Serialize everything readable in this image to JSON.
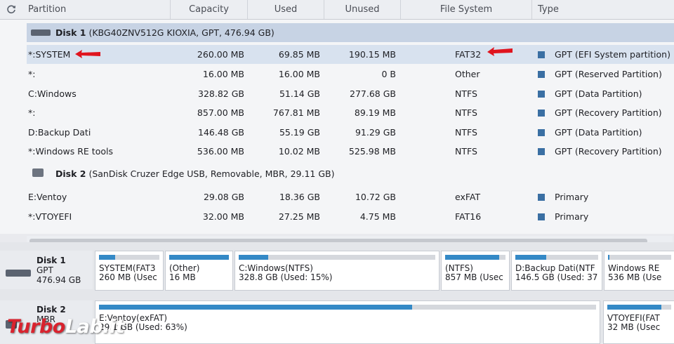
{
  "header": {
    "columns": [
      "Partition",
      "Capacity",
      "Used",
      "Unused",
      "File System",
      "Type"
    ]
  },
  "disk1": {
    "label": "Disk 1",
    "details": "(KBG40ZNV512G KIOXIA, GPT, 476.94 GB)",
    "partitions": [
      {
        "name": "*:SYSTEM",
        "capacity": "260.00 MB",
        "used": "69.85 MB",
        "unused": "190.15 MB",
        "fs": "FAT32",
        "type": "GPT (EFI System partition)"
      },
      {
        "name": "*:",
        "capacity": "16.00 MB",
        "used": "16.00 MB",
        "unused": "0 B",
        "fs": "Other",
        "type": "GPT (Reserved Partition)"
      },
      {
        "name": "C:Windows",
        "capacity": "328.82 GB",
        "used": "51.14 GB",
        "unused": "277.68 GB",
        "fs": "NTFS",
        "type": "GPT (Data Partition)"
      },
      {
        "name": "*:",
        "capacity": "857.00 MB",
        "used": "767.81 MB",
        "unused": "89.19 MB",
        "fs": "NTFS",
        "type": "GPT (Recovery Partition)"
      },
      {
        "name": "D:Backup Dati",
        "capacity": "146.48 GB",
        "used": "55.19 GB",
        "unused": "91.29 GB",
        "fs": "NTFS",
        "type": "GPT (Data Partition)"
      },
      {
        "name": "*:Windows RE tools",
        "capacity": "536.00 MB",
        "used": "10.02 MB",
        "unused": "525.98 MB",
        "fs": "NTFS",
        "type": "GPT (Recovery Partition)"
      }
    ]
  },
  "disk2": {
    "label": "Disk 2",
    "details": "(SanDisk Cruzer Edge USB, Removable, MBR, 29.11 GB)",
    "partitions": [
      {
        "name": "E:Ventoy",
        "capacity": "29.08 GB",
        "used": "18.36 GB",
        "unused": "10.72 GB",
        "fs": "exFAT",
        "type": "Primary"
      },
      {
        "name": "*:VTOYEFI",
        "capacity": "32.00 MB",
        "used": "27.25 MB",
        "unused": "4.75 MB",
        "fs": "FAT16",
        "type": "Primary"
      }
    ]
  },
  "map": {
    "disk1": {
      "title": "Disk 1",
      "line2": "GPT",
      "line3": "476.94 GB",
      "blocks": [
        {
          "l1": "SYSTEM(FAT3",
          "l2": "260 MB (Usec",
          "fill": 0.27
        },
        {
          "l1": "(Other)",
          "l2": "16 MB",
          "fill": 1.0
        },
        {
          "l1": "C:Windows(NTFS)",
          "l2": "328.8 GB (Used: 15%)",
          "fill": 0.15
        },
        {
          "l1": "(NTFS)",
          "l2": "857 MB (Usec",
          "fill": 0.9
        },
        {
          "l1": "D:Backup Dati(NTF",
          "l2": "146.5 GB (Used: 37",
          "fill": 0.37
        },
        {
          "l1": "Windows RE",
          "l2": "536 MB (Use",
          "fill": 0.02
        }
      ]
    },
    "disk2": {
      "title": "Disk 2",
      "line2": "MBR",
      "blocks": [
        {
          "l1": "E:Ventoy(exFAT)",
          "l2": "29.1 GB (Used: 63%)",
          "fill": 0.63
        },
        {
          "l1": "VTOYEFI(FAT",
          "l2": "32 MB (Usec",
          "fill": 0.85
        }
      ]
    }
  },
  "watermark": {
    "part1": "Turbo",
    "part2": "Lab.it"
  },
  "colors": {
    "accent": "#3489c6",
    "selected_row": "#d8e2ef",
    "disk_row": "#c7d3e4",
    "arrow": "#e0141e"
  }
}
